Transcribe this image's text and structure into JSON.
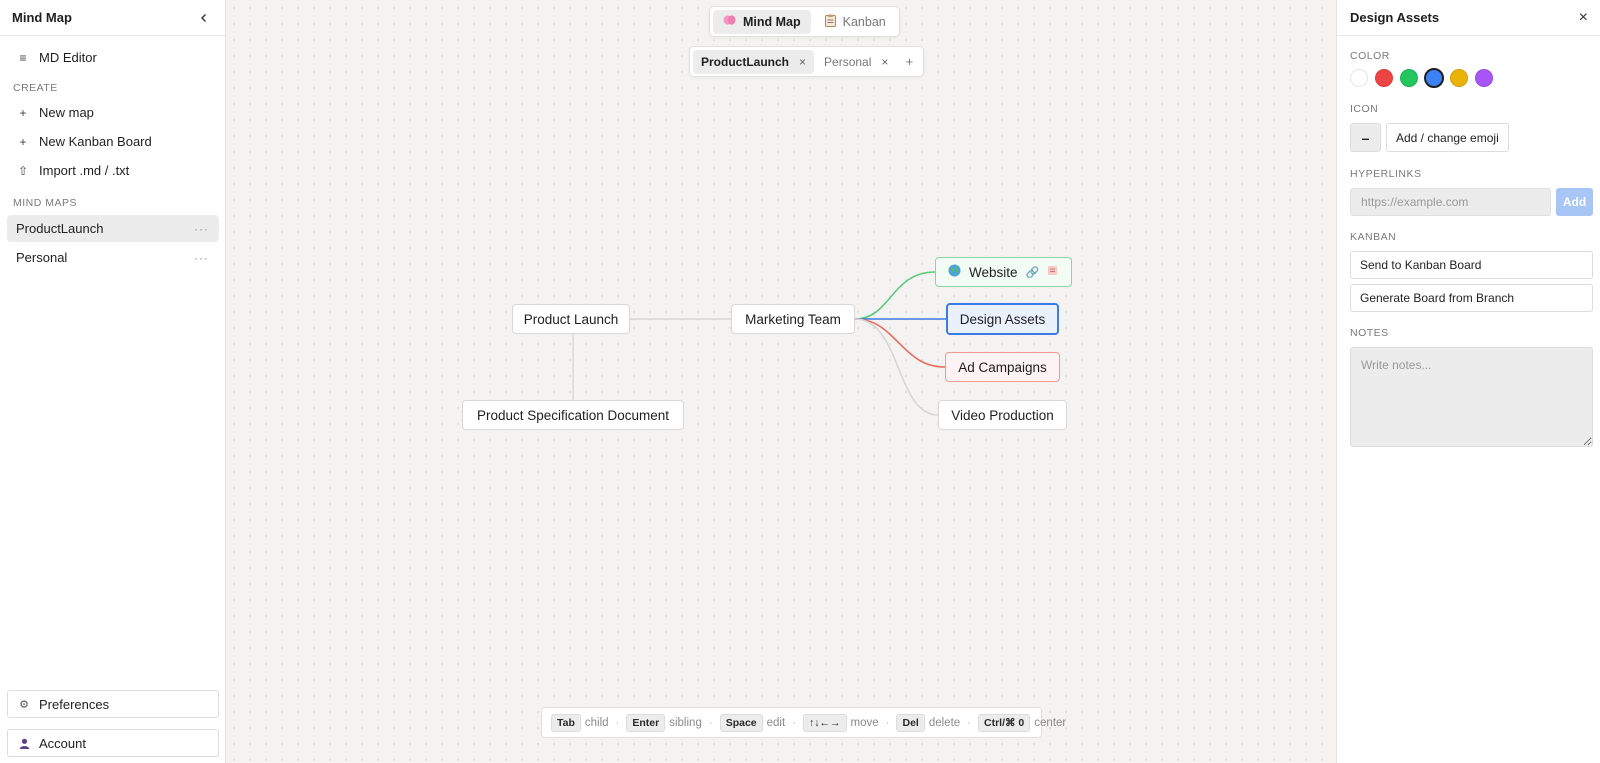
{
  "sidebar": {
    "title": "Mind Map",
    "md_editor": "MD Editor",
    "create_label": "CREATE",
    "new_map": "New map",
    "new_kanban": "New Kanban Board",
    "import": "Import .md / .txt",
    "mindmaps_label": "MIND MAPS",
    "maps": [
      {
        "label": "ProductLaunch",
        "active": true
      },
      {
        "label": "Personal",
        "active": false
      }
    ],
    "more": "···",
    "preferences": "Preferences",
    "account": "Account"
  },
  "modes": [
    {
      "label": "Mind Map",
      "icon": "brain-icon",
      "active": true
    },
    {
      "label": "Kanban",
      "icon": "clipboard-icon",
      "active": false
    }
  ],
  "tabs": [
    {
      "label": "ProductLaunch",
      "active": true
    },
    {
      "label": "Personal",
      "active": false
    }
  ],
  "tab_close": "×",
  "tab_add": "+",
  "mindmap": {
    "nodes": {
      "root": "Product Launch",
      "spec": "Product Specification Document",
      "marketing": "Marketing Team",
      "website": "Website",
      "design": "Design Assets",
      "ads": "Ad Campaigns",
      "video": "Video Production"
    },
    "edge_colors": {
      "website": "#5cc97a",
      "design": "#3b7be8",
      "ads": "#e96b5f",
      "video": "#d6d6d6",
      "default": "#d6d6d6"
    },
    "selected": "design"
  },
  "shortcuts": [
    {
      "key": "Tab",
      "action": "child"
    },
    {
      "key": "Enter",
      "action": "sibling"
    },
    {
      "key": "Space",
      "action": "edit"
    },
    {
      "key": "↑↓←→",
      "action": "move"
    },
    {
      "key": "Del",
      "action": "delete"
    },
    {
      "key": "Ctrl/⌘ 0",
      "action": "center"
    }
  ],
  "panel": {
    "title": "Design Assets",
    "close": "×",
    "color_label": "COLOR",
    "colors": [
      {
        "name": "white",
        "hex": "#ffffff"
      },
      {
        "name": "red",
        "hex": "#ef4444"
      },
      {
        "name": "green",
        "hex": "#22c55e"
      },
      {
        "name": "blue",
        "hex": "#3b82f6",
        "selected": true
      },
      {
        "name": "yellow",
        "hex": "#eab308"
      },
      {
        "name": "purple",
        "hex": "#a855f7"
      }
    ],
    "icon_label": "ICON",
    "icon_value": "–",
    "emoji_button": "Add / change emoji",
    "hyperlinks_label": "HYPERLINKS",
    "link_placeholder": "https://example.com",
    "add_button": "Add",
    "kanban_label": "KANBAN",
    "send_to_kanban": "Send to Kanban Board",
    "generate_board": "Generate Board from Branch",
    "notes_label": "NOTES",
    "notes_placeholder": "Write notes..."
  }
}
